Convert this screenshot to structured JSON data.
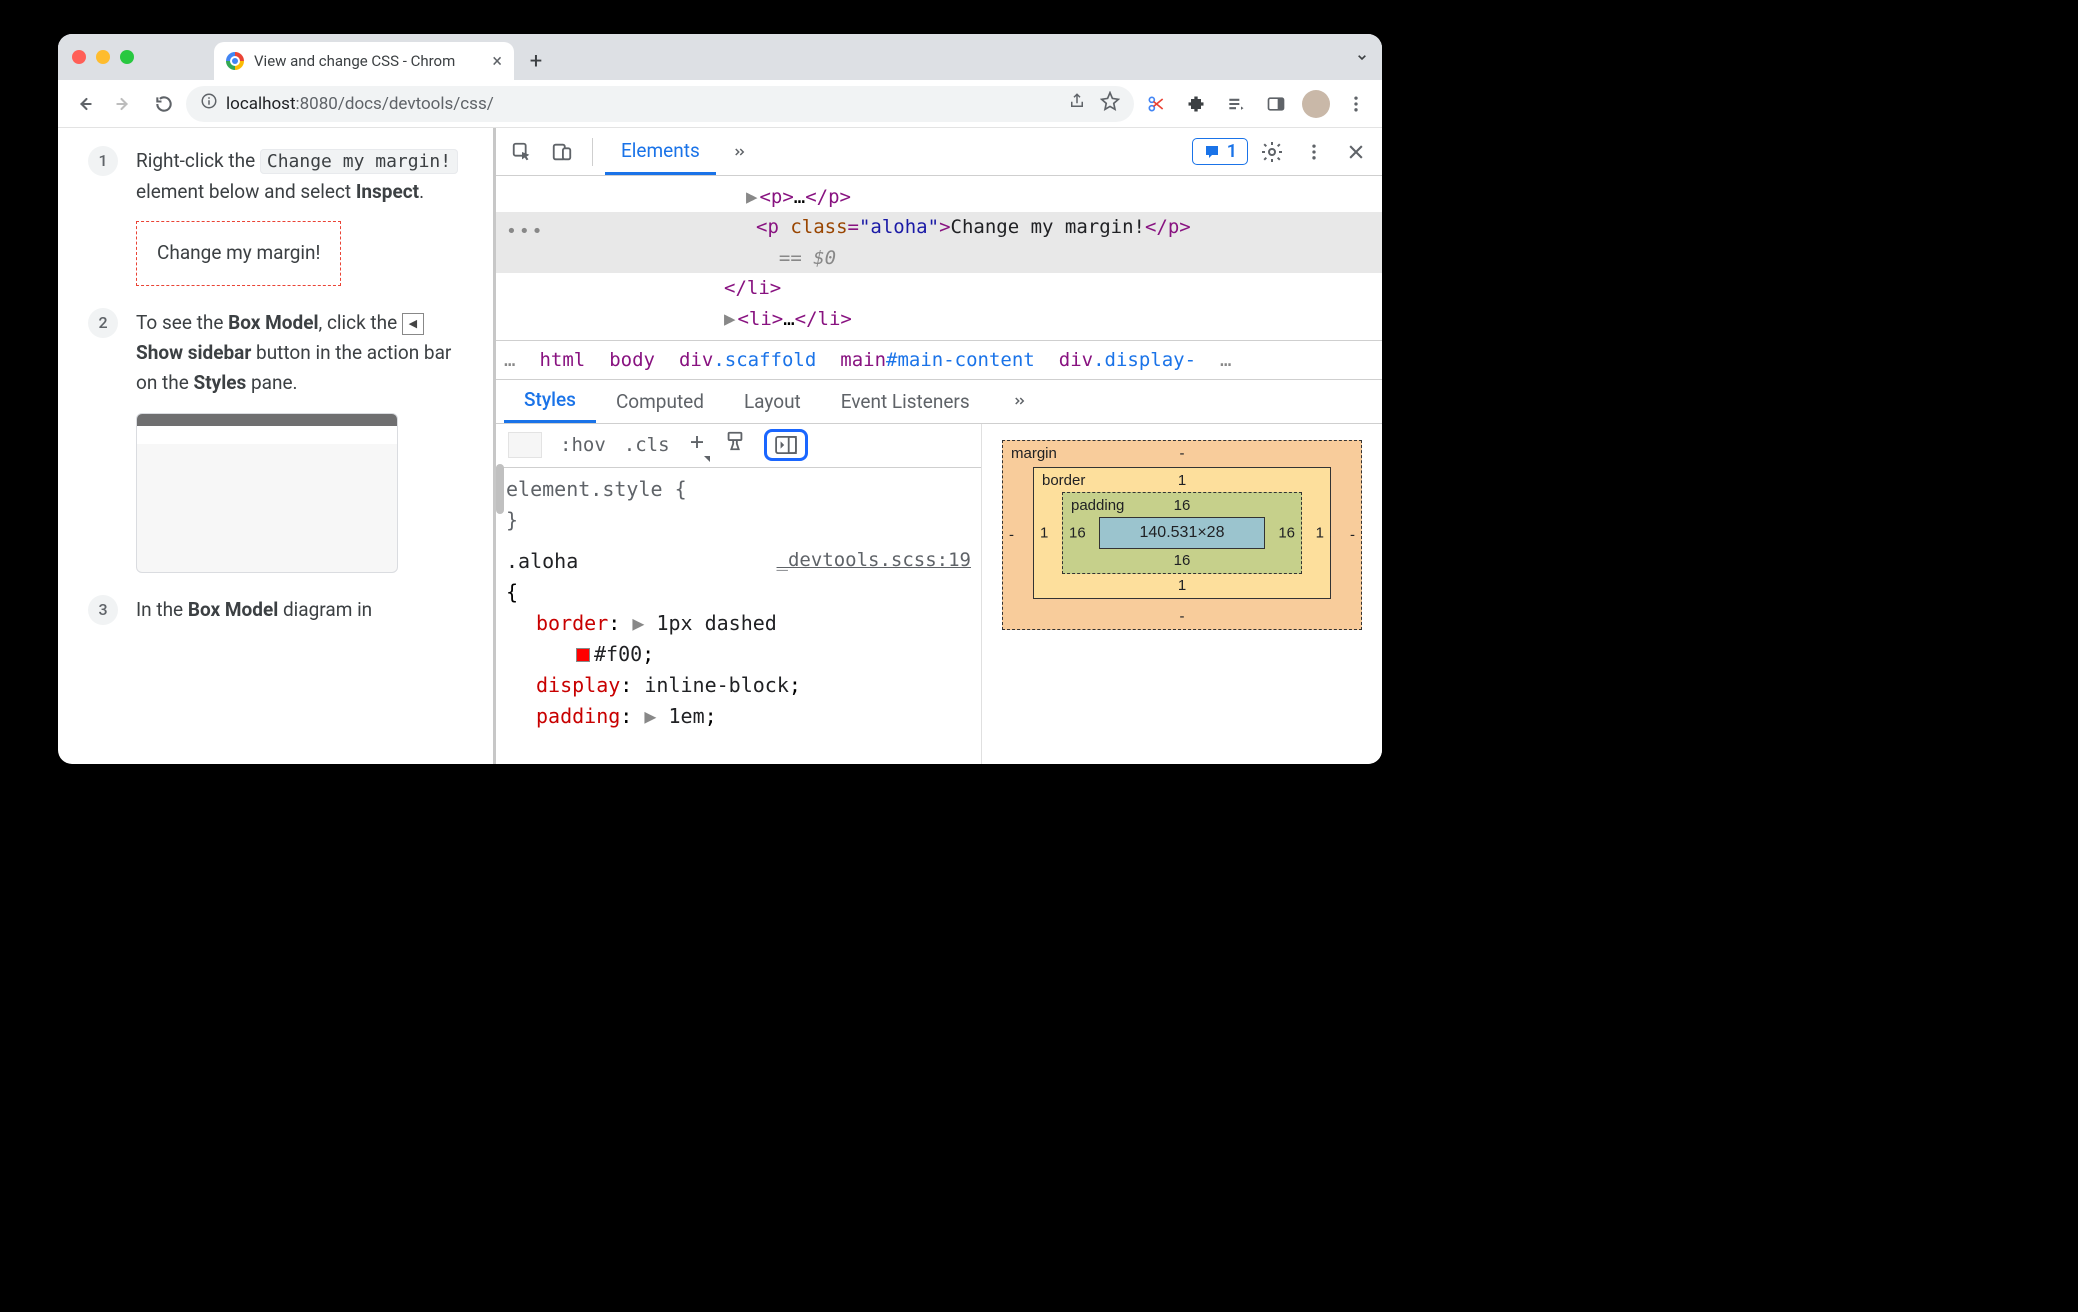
{
  "browser": {
    "tab_title": "View and change CSS - Chrom",
    "url_host": "localhost",
    "url_port": ":8080",
    "url_path": "/docs/devtools/css/"
  },
  "page": {
    "step1_a": "Right-click the ",
    "step1_kbd": "Change my margin!",
    "step1_b": " element below and select ",
    "step1_bold": "Inspect",
    "step1_c": ".",
    "sample_text": "Change my margin!",
    "step2_a": "To see the ",
    "step2_bold1": "Box Model",
    "step2_b": ", click the ",
    "step2_bold2": "Show sidebar",
    "step2_c": " button in the action bar on the ",
    "step2_bold3": "Styles",
    "step2_d": " pane.",
    "step3_a": "In the ",
    "step3_bold": "Box Model",
    "step3_b": " diagram in"
  },
  "devtools": {
    "tabs": {
      "elements": "Elements"
    },
    "issues_count": "1",
    "dom": {
      "p_collapsed_open": "<p>",
      "ellipsis": "…",
      "p_collapsed_close": "</p>",
      "p_open": "<p ",
      "p_attr": "class",
      "p_attr_eq": "=",
      "p_attr_val": "\"aloha\"",
      "p_close_bracket": ">",
      "p_text": "Change my margin!",
      "p_close": "</p>",
      "eq_sel": "== $0",
      "li_close": "</li>",
      "li_open": "<li>",
      "li_ellipsis": "…",
      "li_close2": "</li>"
    },
    "crumbs": {
      "c1": "html",
      "c2": "body",
      "c3_tag": "div",
      "c3_cls": ".scaffold",
      "c4_tag": "main",
      "c4_id": "#main-content",
      "c5_tag": "div",
      "c5_cls": ".display-"
    },
    "styles_tabs": {
      "styles": "Styles",
      "computed": "Computed",
      "layout": "Layout",
      "listeners": "Event Listeners"
    },
    "styles_bar": {
      "hov": ":hov",
      "cls": ".cls"
    },
    "rules": {
      "element_style": "element.style {",
      "element_style_close": "}",
      "aloha_sel": ".aloha",
      "aloha_src": "_devtools.scss:19",
      "open_brace": "{",
      "border_prop": "border",
      "border_val": "1px dashed",
      "border_color": "#f00",
      "display_prop": "display",
      "display_val": "inline-block",
      "padding_prop": "padding",
      "padding_val": "1em",
      "colon": ": ",
      "semi": ";"
    },
    "boxmodel": {
      "margin_label": "margin",
      "margin_t": "-",
      "margin_b": "-",
      "margin_l": "-",
      "margin_r": "-",
      "border_label": "border",
      "border_t": "1",
      "border_b": "1",
      "border_l": "1",
      "border_r": "1",
      "padding_label": "padding",
      "padding_t": "16",
      "padding_b": "16",
      "padding_l": "16",
      "padding_r": "16",
      "content": "140.531×28"
    }
  }
}
